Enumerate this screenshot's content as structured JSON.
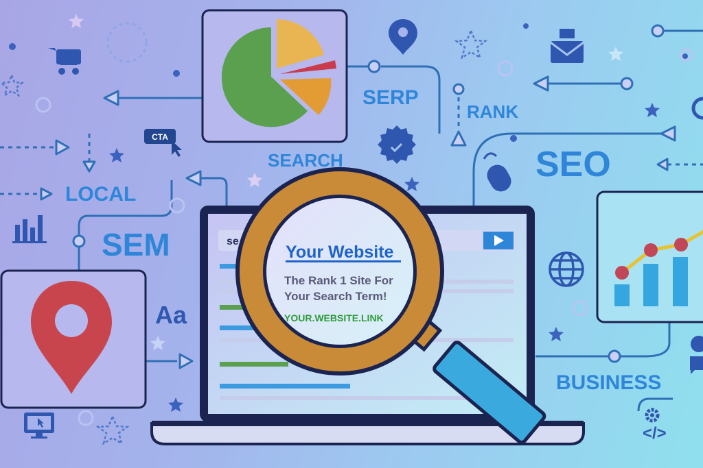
{
  "labels": {
    "serp": "SERP",
    "rank": "RANK",
    "search": "SEARCH",
    "local": "LOCAL",
    "sem": "SEM",
    "seo": "SEO",
    "business": "BUSINESS",
    "cta": "CTA",
    "aa": "Aa",
    "code": "</>"
  },
  "browser": {
    "search_prefix": "se"
  },
  "result": {
    "title": "Your Website",
    "line1": "The Rank 1 Site For",
    "line2": "Your Search Term!",
    "link": "YOUR.WEBSITE.LINK"
  },
  "colors": {
    "label_blue": "#2f86d8",
    "dark_navy": "#1b2350",
    "result_title": "#1e63c8",
    "result_desc": "#5a5a78",
    "result_link": "#2e9b3a",
    "magnifier_ring": "#c98b37",
    "magnifier_handle": "#3aa9dd",
    "pin_red": "#c8454d",
    "pie_green": "#5aa04f",
    "pie_orange": "#e39b34",
    "pie_yellow": "#e8b552",
    "pie_red": "#c93c4b",
    "bar_blue": "#36a6e0",
    "trend_yellow": "#e7c233",
    "dot_red": "#c14758"
  },
  "icons": [
    "shopping-cart-icon",
    "location-pin-icon",
    "envelope-icon",
    "star-icon",
    "cta-cursor-icon",
    "badge-seal-icon",
    "mouse-icon",
    "bar-chart-icon",
    "globe-icon",
    "monitor-cursor-icon",
    "chat-bubbles-icon",
    "gear-icon",
    "code-icon",
    "magnifying-glass-icon",
    "pie-chart-icon",
    "line-bar-chart-icon"
  ]
}
